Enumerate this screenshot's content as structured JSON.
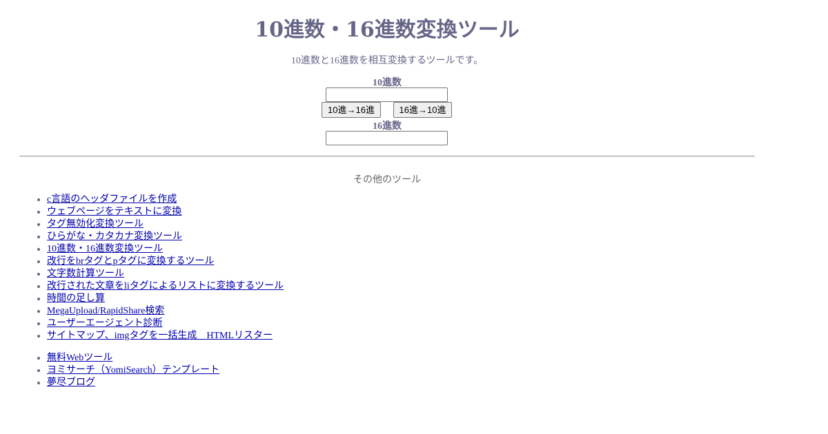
{
  "page": {
    "title": "10進数・16進数変換ツール",
    "description": "10進数と16進数を相互変換するツールです。"
  },
  "converter": {
    "decimal_label": "10進数",
    "decimal_value": "",
    "hex_label": "16進数",
    "hex_value": "",
    "dec_to_hex_button": "10進→16進",
    "hex_to_dec_button": "16進→10進"
  },
  "other_tools": {
    "heading": "その他のツール",
    "links": [
      "c言語のヘッダファイルを作成",
      "ウェブページをテキストに変換",
      "タグ無効化変換ツール",
      "ひらがな・カタカナ変換ツール",
      "10進数・16進数変換ツール",
      "改行をbrタグとpタグに変換するツール",
      "文字数計算ツール",
      "改行された文章をliタグによるリストに変換するツール",
      "時間の足し算",
      "MegaUpload/RapidShare検索",
      "ユーザーエージェント診断",
      "サイトマップ、imgタグを一括生成　HTMLリスター"
    ],
    "site_links": [
      "無料Webツール",
      "ヨミサーチ（YomiSearch）テンプレート",
      "夢尽ブログ"
    ]
  },
  "colors": {
    "text": "#666688",
    "link": "#0000aa"
  }
}
